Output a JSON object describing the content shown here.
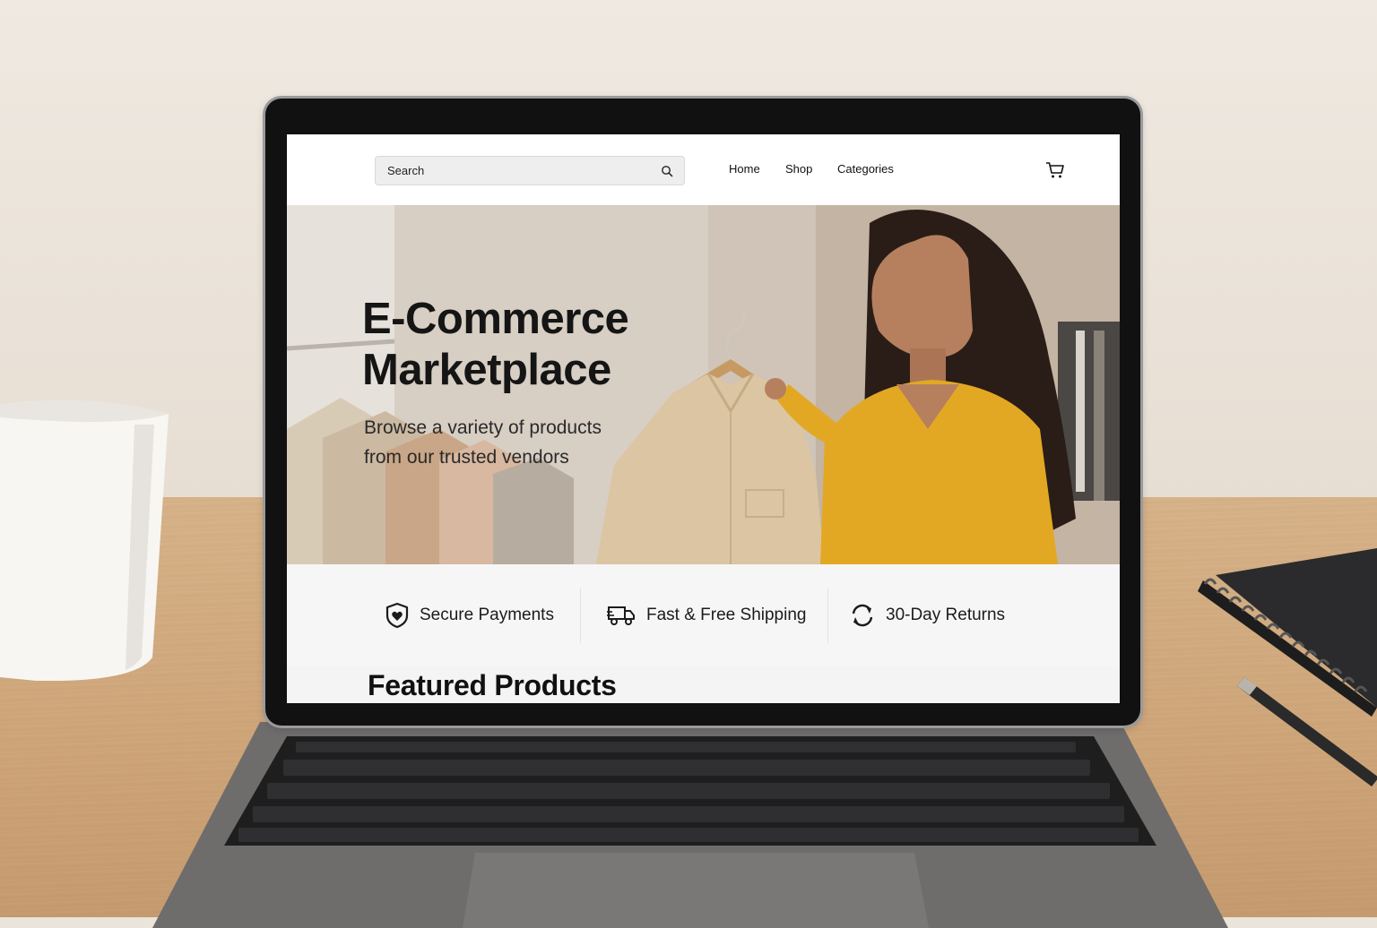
{
  "nav": {
    "search_placeholder": "Search",
    "links": [
      "Home",
      "Shop",
      "Categories"
    ],
    "cart_icon": "cart-icon"
  },
  "hero": {
    "title_line1": "E-Commerce",
    "title_line2": "Marketplace",
    "subtitle_line1": "Browse a variety of products",
    "subtitle_line2": "from our trusted vendors"
  },
  "features": [
    {
      "icon": "shield-icon",
      "label": "Secure Payments"
    },
    {
      "icon": "truck-icon",
      "label": "Fast & Free Shipping"
    },
    {
      "icon": "refresh-icon",
      "label": "30-Day Returns"
    }
  ],
  "featured": {
    "title": "Featured Products"
  },
  "colors": {
    "sweater": "#e3a823",
    "shirt": "#d9bf99",
    "text": "#151515",
    "laptop": "#6e6c6b"
  }
}
